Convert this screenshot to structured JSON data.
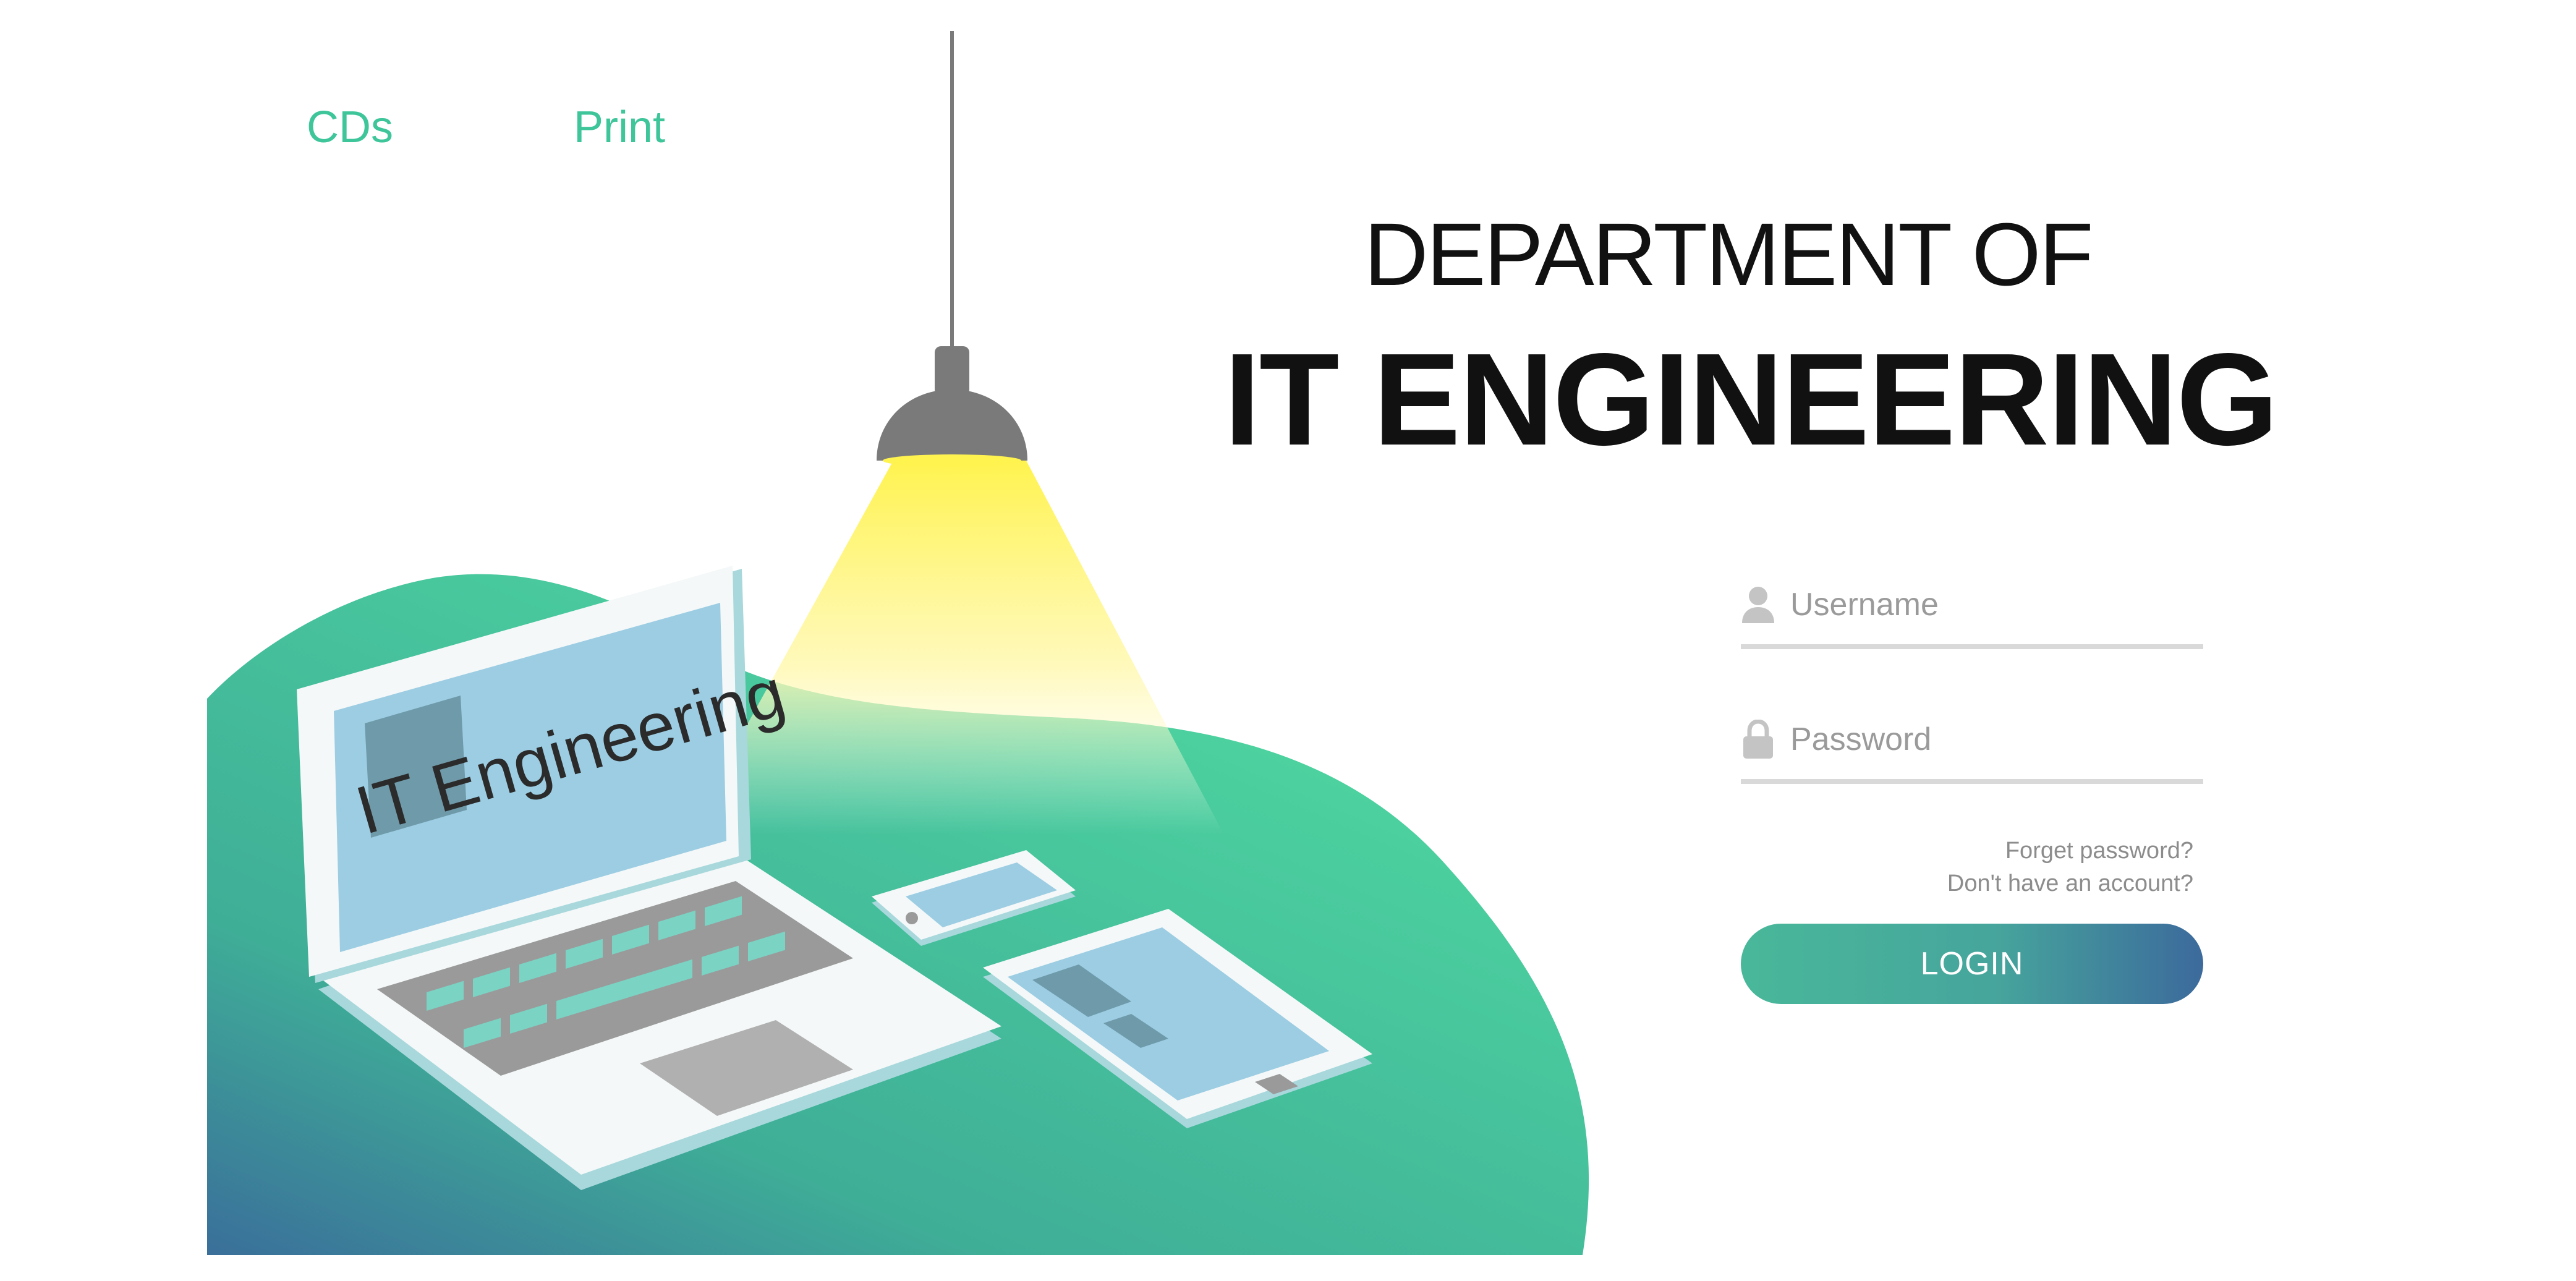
{
  "colors": {
    "accent_green": "#3ec59a",
    "nav_text": "#3ec59a",
    "blob_green": "#4cd19f",
    "blob_blue": "#3a6f9a",
    "lamp_gray": "#7a7a7a",
    "lamp_light": "#fff35a",
    "screen_blue": "#9ccde3",
    "button_start": "#49b89a",
    "button_end": "#3c6a9c",
    "field_line": "#d9d9d9",
    "icon_gray": "#c4c4c4"
  },
  "nav": {
    "items": [
      {
        "label": "CDs"
      },
      {
        "label": "Print"
      }
    ]
  },
  "header": {
    "subtitle": "DEPARTMENT OF",
    "title": "IT ENGINEERING"
  },
  "illustration": {
    "laptop_screen_text": "IT Engineering",
    "icons": [
      "lamp-icon",
      "laptop-icon",
      "phone-icon",
      "tablet-icon"
    ]
  },
  "login_form": {
    "username": {
      "placeholder": "Username",
      "value": "",
      "icon": "user-icon"
    },
    "password": {
      "placeholder": "Password",
      "value": "",
      "icon": "lock-icon"
    },
    "forgot_link": "Forget password?",
    "signup_link": "Don't have an account?",
    "login_label": "LOGIN"
  }
}
